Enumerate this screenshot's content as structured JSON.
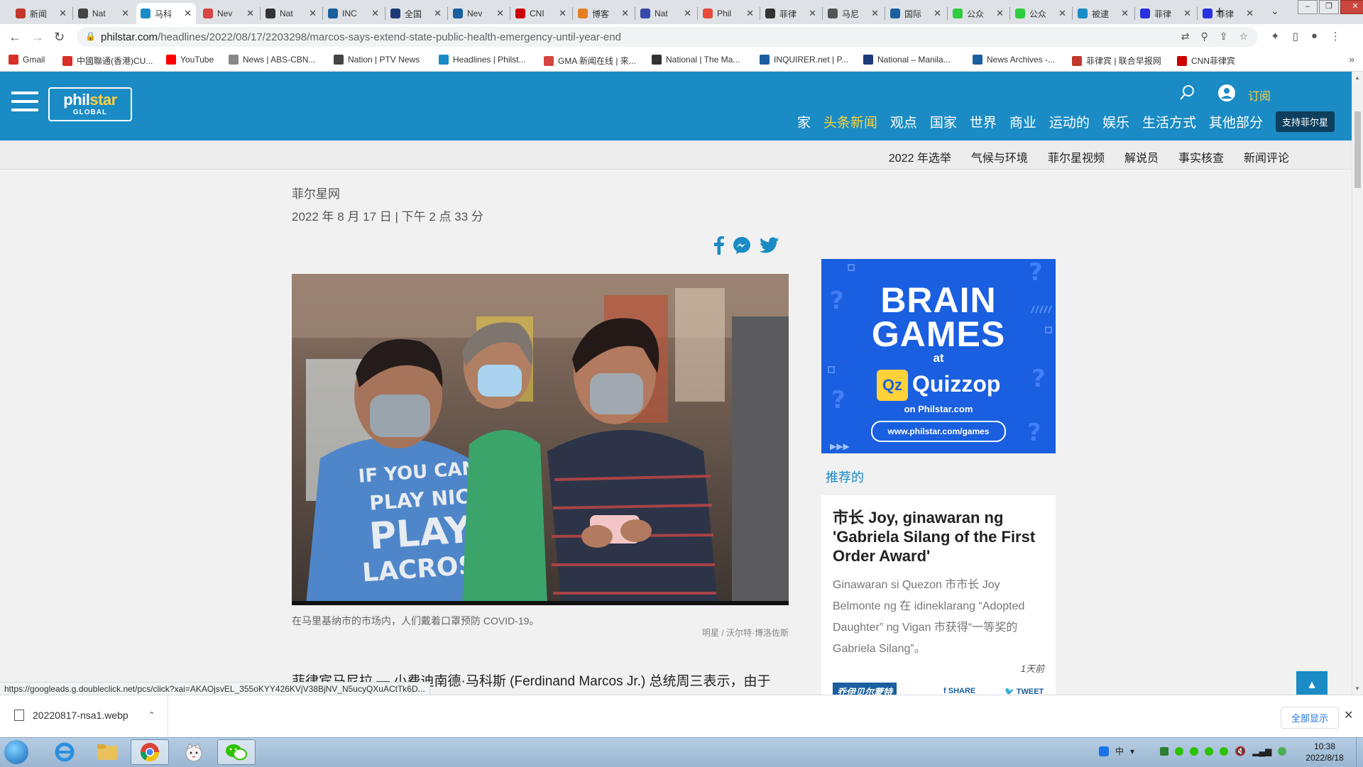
{
  "browser": {
    "tabs": [
      {
        "label": "新闻",
        "favicon": "globe-icon",
        "color": "#c0392b"
      },
      {
        "label": "Nat",
        "favicon": "ptv-icon",
        "color": "#444444"
      },
      {
        "label": "马科",
        "favicon": "philstar-icon",
        "color": "#1a8bc4",
        "active": true
      },
      {
        "label": "Nev",
        "favicon": "gma-icon",
        "color": "#d64541"
      },
      {
        "label": "Nat",
        "favicon": "manila-times-icon",
        "color": "#333333"
      },
      {
        "label": "INC",
        "favicon": "inquirer-icon",
        "color": "#1a5fa0"
      },
      {
        "label": "全国",
        "favicon": "manila-bulletin-icon",
        "color": "#1b3a78"
      },
      {
        "label": "Nev",
        "favicon": "news-icon",
        "color": "#1a5fa0"
      },
      {
        "label": "CNI",
        "favicon": "cnn-icon",
        "color": "#cc0000"
      },
      {
        "label": "博客",
        "favicon": "blog-icon",
        "color": "#e67e22"
      },
      {
        "label": "Nat",
        "favicon": "rappler-icon",
        "color": "#3949ab"
      },
      {
        "label": "Phil",
        "favicon": "phil-icon",
        "color": "#e74c3c"
      },
      {
        "label": "菲律",
        "favicon": "abs-icon",
        "color": "#333333"
      },
      {
        "label": "马尼",
        "favicon": "globe-icon",
        "color": "#555555"
      },
      {
        "label": "国际",
        "favicon": "news-icon",
        "color": "#1a5fa0"
      },
      {
        "label": "公众",
        "favicon": "wechat-icon",
        "color": "#2ecc40"
      },
      {
        "label": "公众",
        "favicon": "wechat-icon",
        "color": "#2ecc40"
      },
      {
        "label": "被逮",
        "favicon": "philstar-icon",
        "color": "#1a8bc4"
      },
      {
        "label": "菲律",
        "favicon": "baidu-icon",
        "color": "#2932e1"
      },
      {
        "label": "菲律",
        "favicon": "baidu-icon",
        "color": "#2932e1"
      }
    ],
    "url_host": "philstar.com",
    "url_path": "/headlines/2022/08/17/2203298/marcos-says-extend-state-public-health-emergency-until-year-end",
    "bookmarks": [
      {
        "label": "Gmail",
        "color": "#d93025"
      },
      {
        "label": "中國聯通(香港)CU...",
        "color": "#d93025"
      },
      {
        "label": "YouTube",
        "color": "#ff0000"
      },
      {
        "label": "News | ABS-CBN...",
        "color": "#888888"
      },
      {
        "label": "Nation | PTV News",
        "color": "#444444"
      },
      {
        "label": "Headlines | Philst...",
        "color": "#1a8bc4"
      },
      {
        "label": "GMA 新闻在线 | 来...",
        "color": "#d64541"
      },
      {
        "label": "National | The Ma...",
        "color": "#333333"
      },
      {
        "label": "INQUIRER.net | P...",
        "color": "#1a5fa0"
      },
      {
        "label": "National – Manila...",
        "color": "#1b3a78"
      },
      {
        "label": "News Archives -...",
        "color": "#1a5fa0"
      },
      {
        "label": "菲律宾 | 联合早报网",
        "color": "#c0392b"
      },
      {
        "label": "CNN菲律宾",
        "color": "#cc0000"
      }
    ]
  },
  "site": {
    "logo_main": "phil",
    "logo_star": "star",
    "logo_sub": "GLOBAL",
    "subscribe": "订阅",
    "nav": [
      "家",
      "头条新闻",
      "观点",
      "国家",
      "世界",
      "商业",
      "运动的",
      "娱乐",
      "生活方式",
      "其他部分"
    ],
    "nav_active": "头条新闻",
    "support": "支持菲尔星",
    "subnav": [
      "2022 年选举",
      "气候与环境",
      "菲尔星视频",
      "解说员",
      "事实核查",
      "新闻评论"
    ]
  },
  "article": {
    "source": "菲尔星网",
    "date": "2022 年 8 月 17 日 | 下午 2 点 33 分",
    "photo_shirt_text": "IF YOU CAN'T PLAY NICE PLAY LACROSSE",
    "caption": "在马里基纳市的市场内，人们戴着口罩预防 COVID-19。",
    "credit": "明星 / 沃尔特·博洛佐斯",
    "text": "菲律宾马尼拉 — 小费迪南德·马科斯 (Ferdinand Marcos Jr.) 总统周三表示，由于"
  },
  "ad": {
    "title1": "BRAIN",
    "title2": "GAMES",
    "at": "at",
    "badge": "Qz",
    "brand": "Quizzop",
    "on": "on Philstar.com",
    "url": "www.philstar.com/games"
  },
  "recommended": {
    "heading": "推荐的",
    "card_title": "市长 Joy, ginawaran ng 'Gabriela Silang of the First Order Award'",
    "card_text": "Ginawaran si Quezon 市市长 Joy Belmonte ng 在 idineklarang “Adopted Daughter” ng Vigan 市获得“一等奖的 Gabriela Silang”。",
    "time": "1天前",
    "author": "乔伊贝尔蒙特",
    "share": "SHARE",
    "tweet": "TWEET"
  },
  "status_url": "https://googleads.g.doubleclick.net/pcs/click?xai=AKAOjsvEL_355oKYY426KVjV38BjNV_N5ucyQXuACtTk6D...",
  "downloads": {
    "file": "20220817-nsa1.webp",
    "show_all": "全部显示"
  },
  "taskbar": {
    "apps": [
      "ie-icon",
      "explorer-icon",
      "chrome-icon",
      "cat-icon",
      "wechat-icon"
    ],
    "ime": "中",
    "time": "10:38",
    "date": "2022/8/18"
  },
  "colors": {
    "header_blue": "#1a8bc4",
    "accent_yellow": "#ffd23a",
    "ad_blue": "#1a5fe0"
  }
}
